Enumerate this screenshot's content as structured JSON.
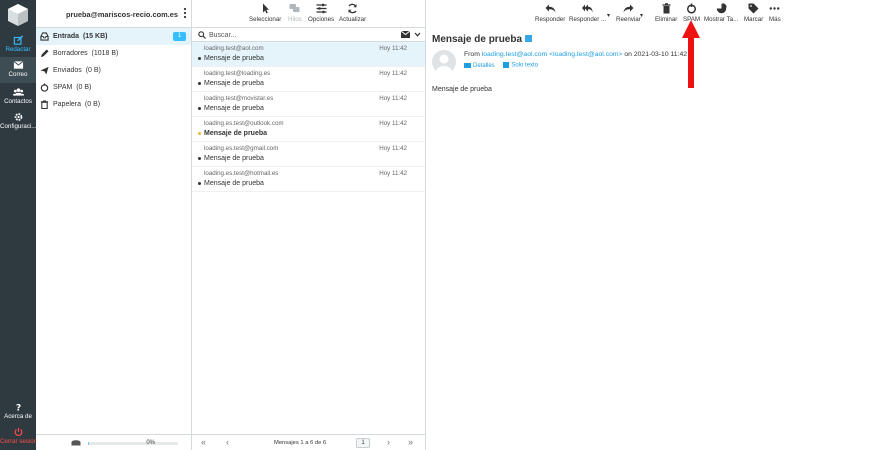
{
  "nav": {
    "compose": "Redactar",
    "mail": "Correo",
    "contacts": "Contactos",
    "settings": "Configuraci...",
    "about": "Acerca de",
    "logout": "Cerrar sesión"
  },
  "account": "prueba@mariscos-recio.com.es",
  "folders": [
    {
      "name": "Entrada",
      "size": "(15 KB)",
      "badge": "1"
    },
    {
      "name": "Borradores",
      "size": "(1018 B)"
    },
    {
      "name": "Enviados",
      "size": "(0 B)"
    },
    {
      "name": "SPAM",
      "size": "(0 B)"
    },
    {
      "name": "Papelera",
      "size": "(0 B)"
    }
  ],
  "quota": {
    "percent": "0%",
    "fraction": 0.01
  },
  "list_toolbar": {
    "select": "Seleccionar",
    "threads": "Hilos",
    "options": "Opciones",
    "refresh": "Actualizar"
  },
  "search": {
    "placeholder": "Buscar..."
  },
  "messages": [
    {
      "from": "loading.test@aol.com",
      "date": "Hoy 11:42",
      "subject": "Mensaje de prueba",
      "unread": false
    },
    {
      "from": "loading.test@loading.es",
      "date": "Hoy 11:42",
      "subject": "Mensaje de prueba",
      "unread": false
    },
    {
      "from": "loading.test@movistar.es",
      "date": "Hoy 11:42",
      "subject": "Mensaje de prueba",
      "unread": false
    },
    {
      "from": "loading.es.test@outlook.com",
      "date": "Hoy 11:42",
      "subject": "Mensaje de prueba",
      "unread": true
    },
    {
      "from": "loading.es.test@gmail.com",
      "date": "Hoy 11:42",
      "subject": "Mensaje de prueba",
      "unread": false
    },
    {
      "from": "loading.es.test@hotmail.es",
      "date": "Hoy 11:42",
      "subject": "Mensaje de prueba",
      "unread": false
    }
  ],
  "pager": {
    "count": "Mensajes 1 a 6 de 6",
    "page": "1"
  },
  "reader_toolbar": {
    "reply": "Responder",
    "reply_all": "Responder ...",
    "forward": "Reenviar",
    "delete": "Eliminar",
    "spam": "SPAM",
    "show": "Mostrar Ta...",
    "mark": "Marcar",
    "more": "Más"
  },
  "email": {
    "subject": "Mensaje de prueba",
    "from_label": "From",
    "from_address": "loading.test@aol.com <loading.test@aol.com>",
    "on_text": "on 2021-03-10 11:42",
    "details": "Detalles",
    "plain": "Solo texto",
    "body": "Mensaje de prueba"
  },
  "colors": {
    "accent": "#37beff",
    "nav_bg": "#2f3a40",
    "arrow": "#ee1111"
  }
}
